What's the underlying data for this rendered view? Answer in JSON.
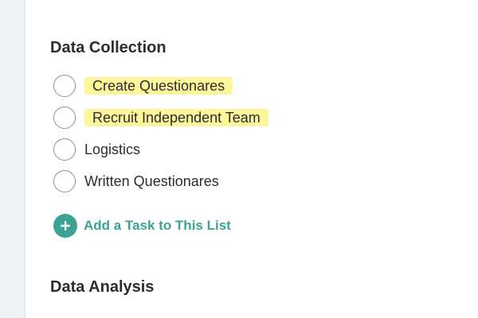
{
  "sections": [
    {
      "title": "Data Collection",
      "tasks": [
        {
          "label": "Create Questionares",
          "highlighted": true
        },
        {
          "label": "Recruit Independent Team",
          "highlighted": true
        },
        {
          "label": "Logistics",
          "highlighted": false
        },
        {
          "label": "Written Questionares",
          "highlighted": false
        }
      ],
      "add_task_label": "Add a Task to This List"
    },
    {
      "title": "Data Analysis"
    }
  ],
  "colors": {
    "accent": "#3aa394",
    "highlight": "#fff59a",
    "text": "#2b2d30",
    "checkbox_border": "#8d9096",
    "sidebar_bg": "#f1f2f4"
  },
  "icons": {
    "add": "plus-icon"
  }
}
